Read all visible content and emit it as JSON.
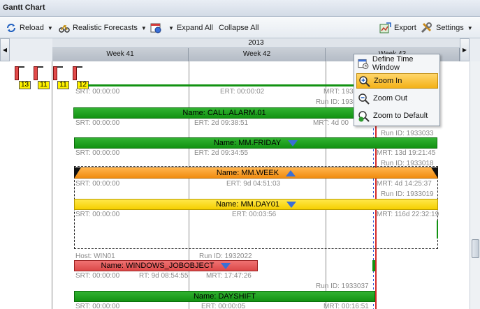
{
  "window": {
    "title": "Gantt Chart"
  },
  "toolbar": {
    "reload": "Reload",
    "forecasts": "Realistic Forecasts",
    "expand_all": "Expand All",
    "collapse_all": "Collapse All",
    "export": "Export",
    "settings": "Settings"
  },
  "timeline": {
    "year": "2013",
    "weeks": [
      "Week 41",
      "Week 42",
      "Week 43"
    ]
  },
  "markers": [
    "13",
    "11",
    "11",
    "12"
  ],
  "rows": {
    "top_info": {
      "srt": "SRT: 00:00:00",
      "ert": "ERT: 00:00:02",
      "mrt": "MRT: 1933",
      "run": "Run ID: 1933"
    },
    "call_alarm": {
      "name": "Name: CALL.ALARM.01",
      "srt": "SRT: 00:00:00",
      "ert": "ERT: 2d 09:38:51",
      "mrt": "MRT: 4d 00",
      "run": "Run ID: 1933033"
    },
    "mm_friday": {
      "name": "Name: MM.FRIDAY",
      "srt": "SRT: 00:00:00",
      "ert": "ERT: 2d 09:34:55",
      "mrt": "MRT: 13d 19:21:45",
      "run": "Run ID: 1933018"
    },
    "mm_week": {
      "name": "Name: MM.WEEK",
      "srt": "SRT: 00:00:00",
      "ert": "ERT: 9d 04:51:03",
      "mrt": "MRT: 4d 14:25:37",
      "run": "Run ID: 1933019"
    },
    "mm_day01": {
      "name": "Name: MM.DAY01",
      "srt": "SRT: 00:00:00",
      "ert": "ERT: 00:03:56",
      "mrt": "MRT: 116d 22:32:19"
    },
    "windows_job": {
      "host": "Host: WIN01",
      "run_top": "Run ID: 1932022",
      "name": "Name: WINDOWS_JOBOBJECT",
      "srt": "SRT: 00:00:00",
      "rt": "RT: 9d 08:54:55",
      "mrt": "MRT: 17:47:26",
      "run": "Run ID: 1933037"
    },
    "dayshift": {
      "name": "Name: DAYSHIFT",
      "srt": "SRT: 00:00:00",
      "ert": "ERT: 00:00:05",
      "mrt": "MRT: 00:16:51"
    }
  },
  "zoom_menu": {
    "define_window": "Define Time Window",
    "zoom_in": "Zoom In",
    "zoom_out": "Zoom Out",
    "zoom_default": "Zoom to Default"
  },
  "colors": {
    "accent": "#f3b118",
    "bar_green": "#129212",
    "bar_orange": "#f08c10",
    "bar_yellow": "#f5cf00",
    "bar_red": "#dc4848",
    "now_line": "#d42a2a"
  }
}
